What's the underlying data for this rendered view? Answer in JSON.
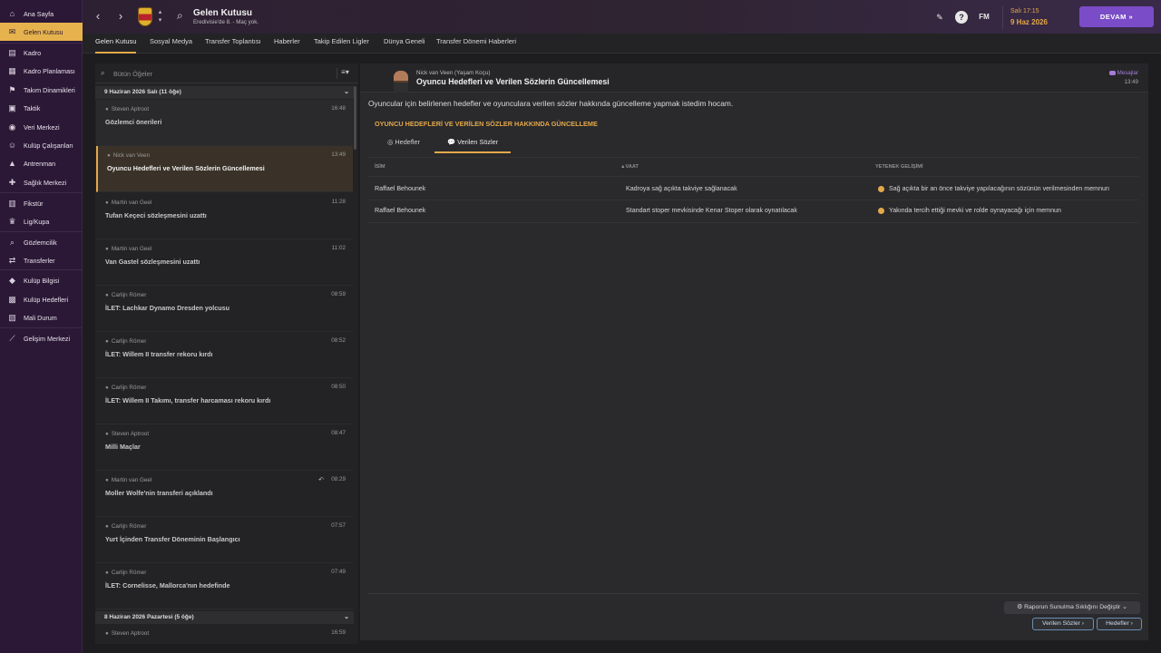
{
  "sidebar": {
    "items": [
      {
        "label": "Ana Sayfa",
        "icon": "home-icon",
        "glyph": "⌂"
      },
      {
        "label": "Gelen Kutusu",
        "icon": "inbox-icon",
        "glyph": "✉"
      },
      {
        "label": "Kadro",
        "icon": "squad-icon",
        "glyph": "▤"
      },
      {
        "label": "Kadro Planlaması",
        "icon": "squad-planner-icon",
        "glyph": "▦"
      },
      {
        "label": "Takım Dinamikleri",
        "icon": "dynamics-icon",
        "glyph": "⚑"
      },
      {
        "label": "Taktik",
        "icon": "tactics-icon",
        "glyph": "▣"
      },
      {
        "label": "Veri Merkezi",
        "icon": "data-hub-icon",
        "glyph": "◉"
      },
      {
        "label": "Kulüp Çalışanları",
        "icon": "staff-icon",
        "glyph": "☺"
      },
      {
        "label": "Antrenman",
        "icon": "training-icon",
        "glyph": "▲"
      },
      {
        "label": "Sağlık Merkezi",
        "icon": "medical-icon",
        "glyph": "✚"
      },
      {
        "label": "Fikstür",
        "icon": "fixtures-icon",
        "glyph": "▥"
      },
      {
        "label": "Lig/Kupa",
        "icon": "trophy-icon",
        "glyph": "♛"
      },
      {
        "label": "Gözlemcilik",
        "icon": "scouting-icon",
        "glyph": "⌕"
      },
      {
        "label": "Transferler",
        "icon": "transfers-icon",
        "glyph": "⇄"
      },
      {
        "label": "Kulüp Bilgisi",
        "icon": "club-info-icon",
        "glyph": "◆"
      },
      {
        "label": "Kulüp Hedefleri",
        "icon": "club-vision-icon",
        "glyph": "▩"
      },
      {
        "label": "Mali Durum",
        "icon": "finances-icon",
        "glyph": "▧"
      },
      {
        "label": "Gelişim Merkezi",
        "icon": "development-icon",
        "glyph": "⟋"
      }
    ]
  },
  "topbar": {
    "title": "Gelen Kutusu",
    "subtitle": "Eredivisie'de 8. - Maç yok.",
    "clock": "Salı 17:15",
    "date": "9 Haz 2026",
    "fm_label": "FM",
    "continue_label": "DEVAM  »"
  },
  "tabs": [
    "Gelen Kutusu",
    "Sosyal Medya",
    "Transfer Toplantısı",
    "Haberler",
    "Takip Edilen Ligler",
    "Dünya Geneli",
    "Transfer Dönemi Haberleri"
  ],
  "list": {
    "search_placeholder": "Bütün Öğeler",
    "group1": "9 Haziran 2026 Salı (11 öğe)",
    "group2": "8 Haziran 2026 Pazartesi (5 öğe)",
    "messages": [
      {
        "sender": "Steven Aptroot",
        "time": "16:48",
        "subject": "Gözlemci önerileri"
      },
      {
        "sender": "Nick van Veen",
        "time": "13:49",
        "subject": "Oyuncu Hedefleri ve Verilen Sözlerin Güncellemesi"
      },
      {
        "sender": "Martin van Geel",
        "time": "11:28",
        "subject": "Tufan Keçeci sözleşmesini uzattı"
      },
      {
        "sender": "Martin van Geel",
        "time": "11:02",
        "subject": "Van Gastel sözleşmesini uzattı"
      },
      {
        "sender": "Carlijn Römer",
        "time": "08:59",
        "subject": "İLET: Lachkar Dynamo Dresden yolcusu"
      },
      {
        "sender": "Carlijn Römer",
        "time": "08:52",
        "subject": "İLET: Willem II transfer rekoru kırdı"
      },
      {
        "sender": "Carlijn Römer",
        "time": "08:50",
        "subject": "İLET: Willem II Takımı, transfer harcaması rekoru kırdı"
      },
      {
        "sender": "Steven Aptroot",
        "time": "08:47",
        "subject": "Milli Maçlar"
      },
      {
        "sender": "Martin van Geel",
        "time": "08:29",
        "subject": "Moller Wolfe'nin transferi açıklandı"
      },
      {
        "sender": "Carlijn Römer",
        "time": "07:57",
        "subject": "Yurt İçinden Transfer Döneminin Başlangıcı"
      },
      {
        "sender": "Carlijn Römer",
        "time": "07:49",
        "subject": "İLET: Cornelisse, Mallorca'nın hedefinde"
      }
    ],
    "next_sender": "Steven Aptroot",
    "next_time": "16:59"
  },
  "detail": {
    "from": "Nick van Veen  (Yaşam Koçu)",
    "title": "Oyuncu Hedefleri ve Verilen Sözlerin Güncellemesi",
    "tag": "Mesajlar",
    "time": "13:49",
    "intro": "Oyuncular için belirlenen hedefler ve oyunculara verilen sözler hakkında güncelleme yapmak istedim hocam.",
    "section": "OYUNCU HEDEFLERİ VE VERİLEN SÖZLER HAKKINDA GÜNCELLEME",
    "tab_goals": "Hedefler",
    "tab_promises": "Verilen Sözler",
    "col_name": "İSİM",
    "col_promise": "VAAT",
    "col_progress": "YETENEK GELİŞİMİ",
    "rows": [
      {
        "name": "Raffael Behounek",
        "promise": "Kadroya sağ açıkta takviye sağlanacak",
        "progress": "Sağ açıkta bir an önce takviye yapılacağının sözünün verilmesinden memnun"
      },
      {
        "name": "Raffael Behounek",
        "promise": "Standart stoper mevkisinde Kenar Stoper olarak oynatılacak",
        "progress": "Yakında tercih ettiği mevki ve rolde oynayacağı için memnun"
      }
    ],
    "report_btn": "Raporun Sunulma Sıklığını Değiştir",
    "btn_promises": "Verilen Sözler",
    "btn_goals": "Hedefler"
  },
  "colors": {
    "accent": "#e3a84a",
    "sidebar": "#2b1836",
    "continue": "#7a4cc7",
    "link": "#6b8db6"
  }
}
